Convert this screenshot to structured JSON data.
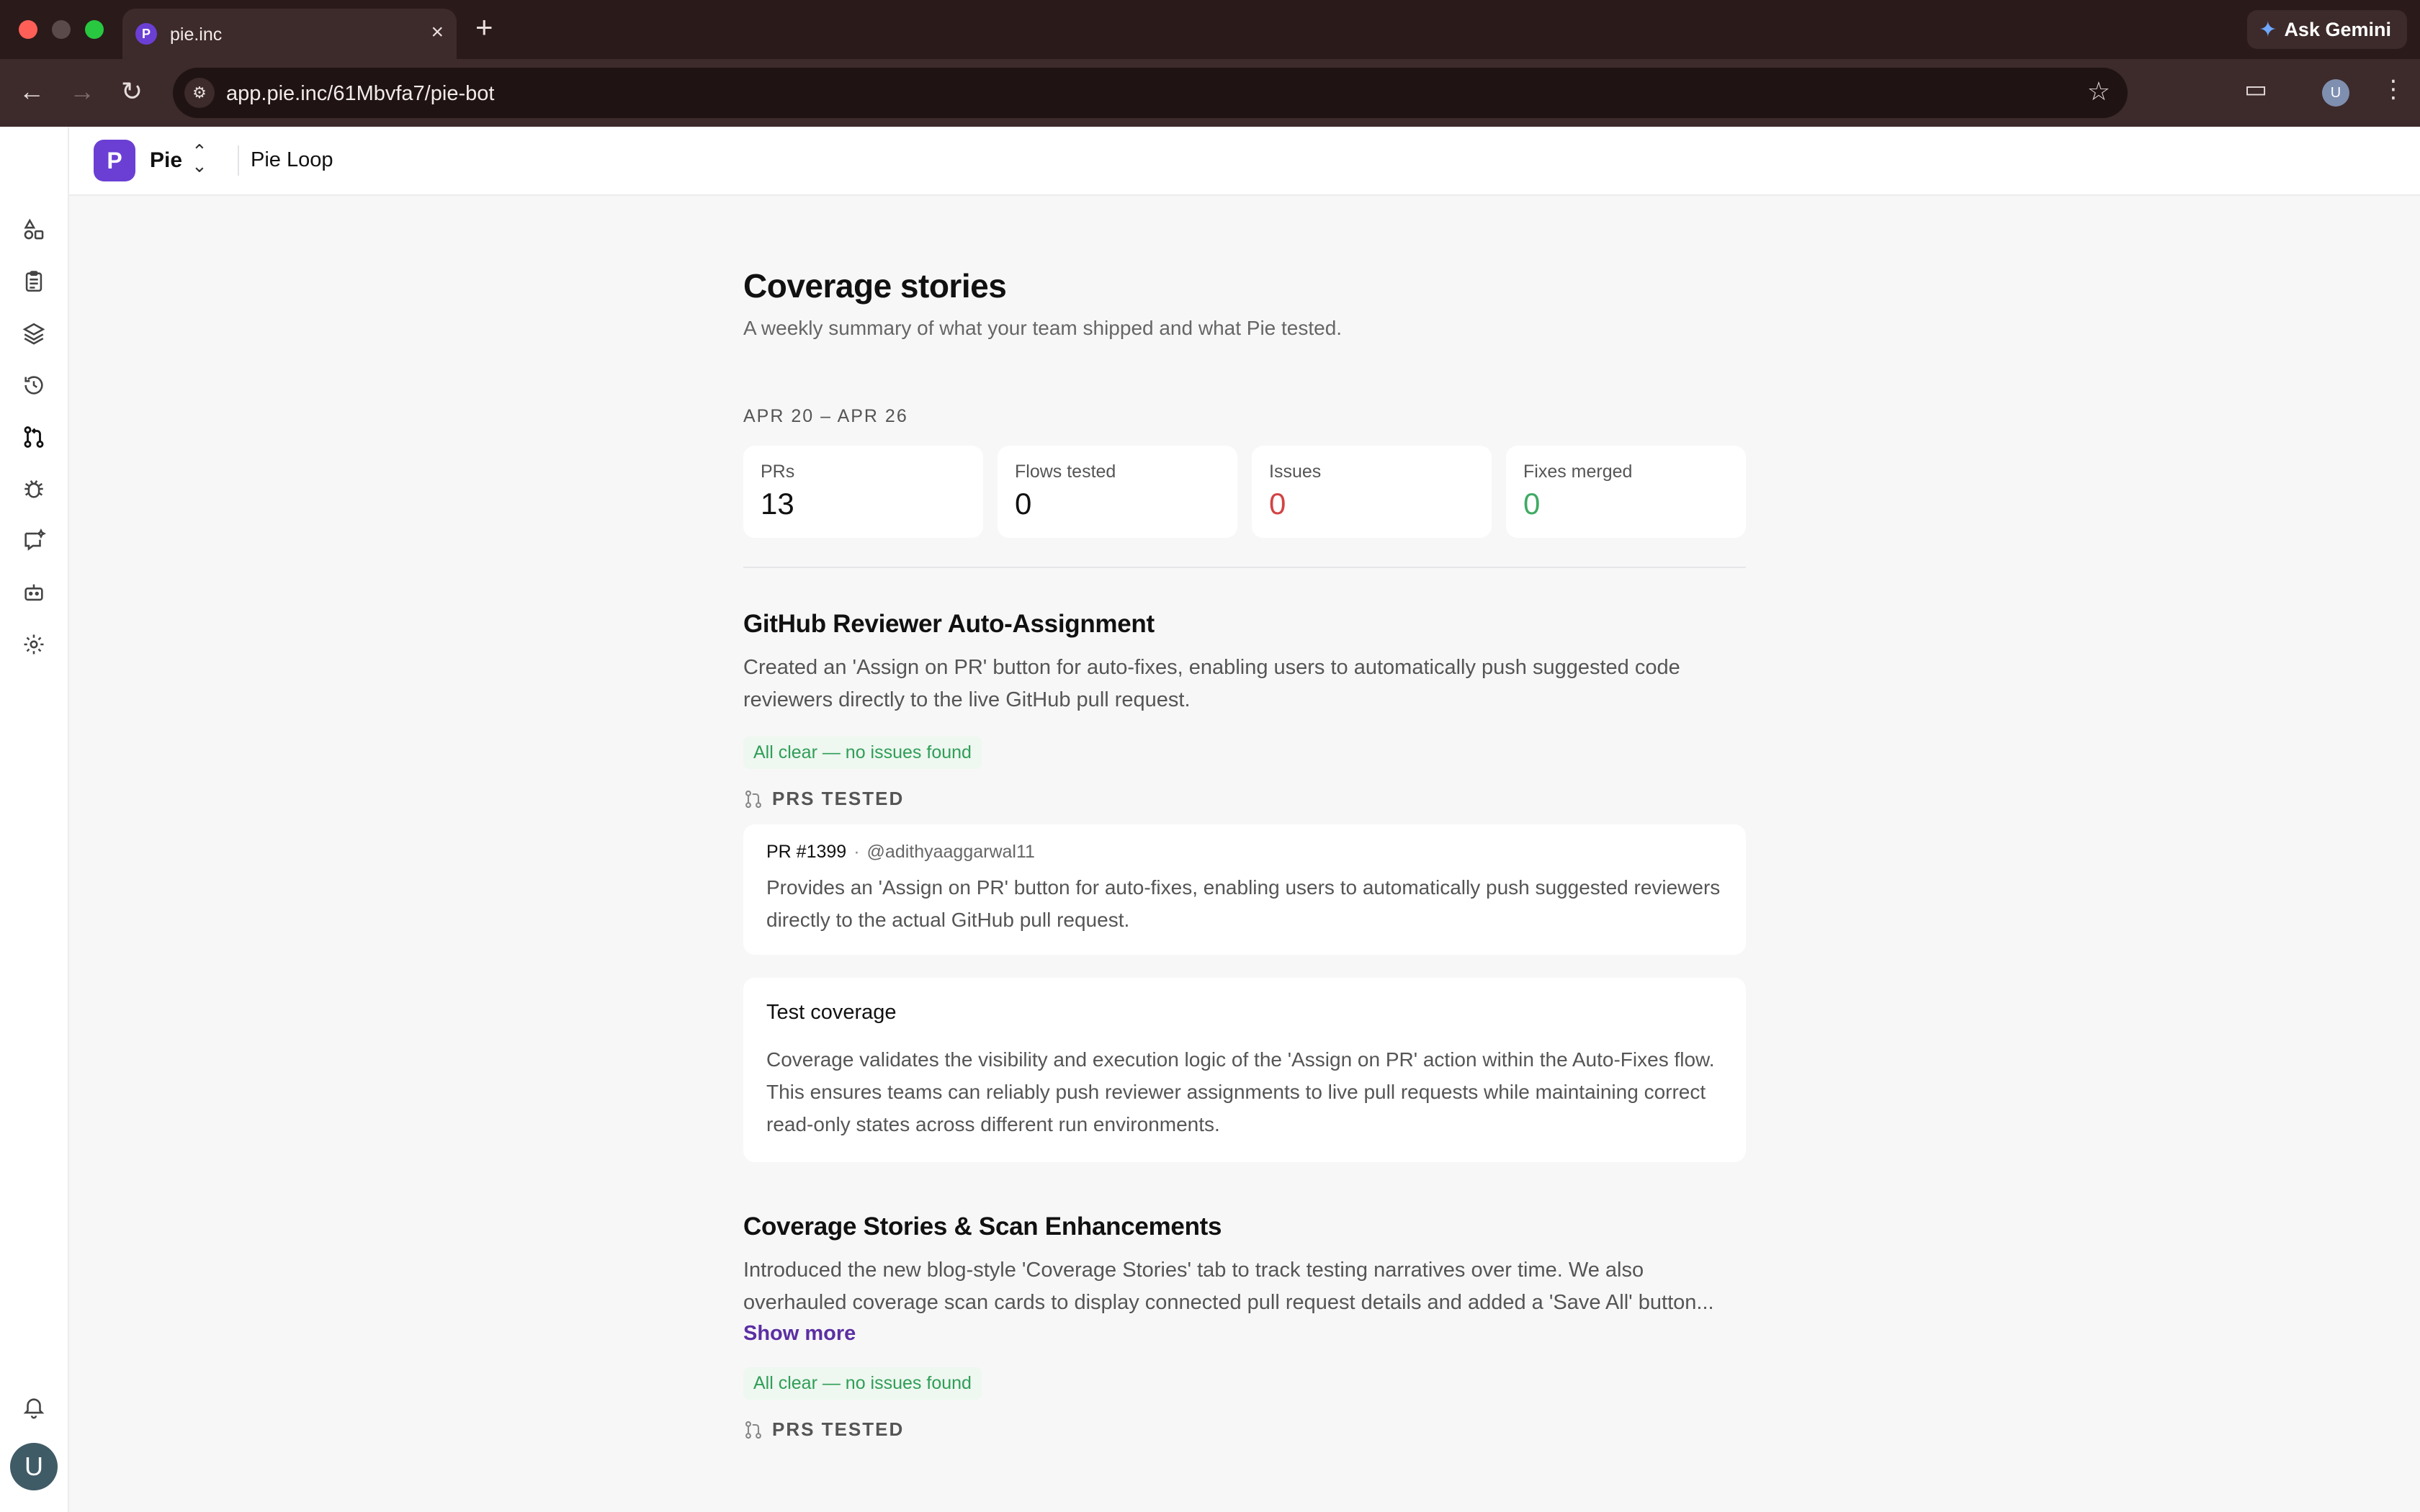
{
  "browser": {
    "tab_title": "pie.inc",
    "tab_favicon": "P",
    "new_tab_icon": "+",
    "url": "app.pie.inc/61Mbvfa7/pie-bot",
    "gemini_label": "Ask Gemini",
    "profile_initial": "U"
  },
  "header": {
    "brand_logo": "P",
    "brand_name": "Pie",
    "breadcrumb": "Pie Loop"
  },
  "rail": {
    "icons": [
      "shapes-icon",
      "clipboard-icon",
      "layers-icon",
      "history-icon",
      "pull-request-icon",
      "bug-icon",
      "chat-sparkle-icon",
      "bot-icon",
      "gear-icon"
    ],
    "active": "pull-request-icon",
    "bottom_icon": "bell-icon",
    "avatar_initial": "U"
  },
  "page": {
    "title": "Coverage stories",
    "subtitle": "A weekly summary of what your team shipped and what Pie tested.",
    "week_label": "APR 20 – APR 26"
  },
  "stats": [
    {
      "label": "PRs",
      "value": "13",
      "color": "#111111"
    },
    {
      "label": "Flows tested",
      "value": "0",
      "color": "#111111"
    },
    {
      "label": "Issues",
      "value": "0",
      "color": "#d24444"
    },
    {
      "label": "Fixes merged",
      "value": "0",
      "color": "#3faa63"
    }
  ],
  "stories": [
    {
      "title": "GitHub Reviewer Auto-Assignment",
      "description": "Created an 'Assign on PR' button for auto-fixes, enabling users to automatically push suggested code reviewers directly to the live GitHub pull request.",
      "badge": "All clear — no issues found",
      "prs_label": "PRS TESTED",
      "pr": {
        "number": "PR #1399",
        "author": "@adithyaaggarwal11",
        "summary": "Provides an 'Assign on PR' button for auto-fixes, enabling users to automatically push suggested reviewers directly to the actual GitHub pull request."
      },
      "coverage": {
        "title": "Test coverage",
        "text": "Coverage validates the visibility and execution logic of the 'Assign on PR' action within the Auto-Fixes flow. This ensures teams can reliably push reviewer assignments to live pull requests while maintaining correct read-only states across different run environments."
      }
    },
    {
      "title": "Coverage Stories & Scan Enhancements",
      "description": "Introduced the new blog-style 'Coverage Stories' tab to track testing narratives over time. We also overhauled coverage scan cards to display connected pull request details and added a 'Save All' button...",
      "show_more": "Show more",
      "badge": "All clear — no issues found",
      "prs_label": "PRS TESTED"
    }
  ]
}
